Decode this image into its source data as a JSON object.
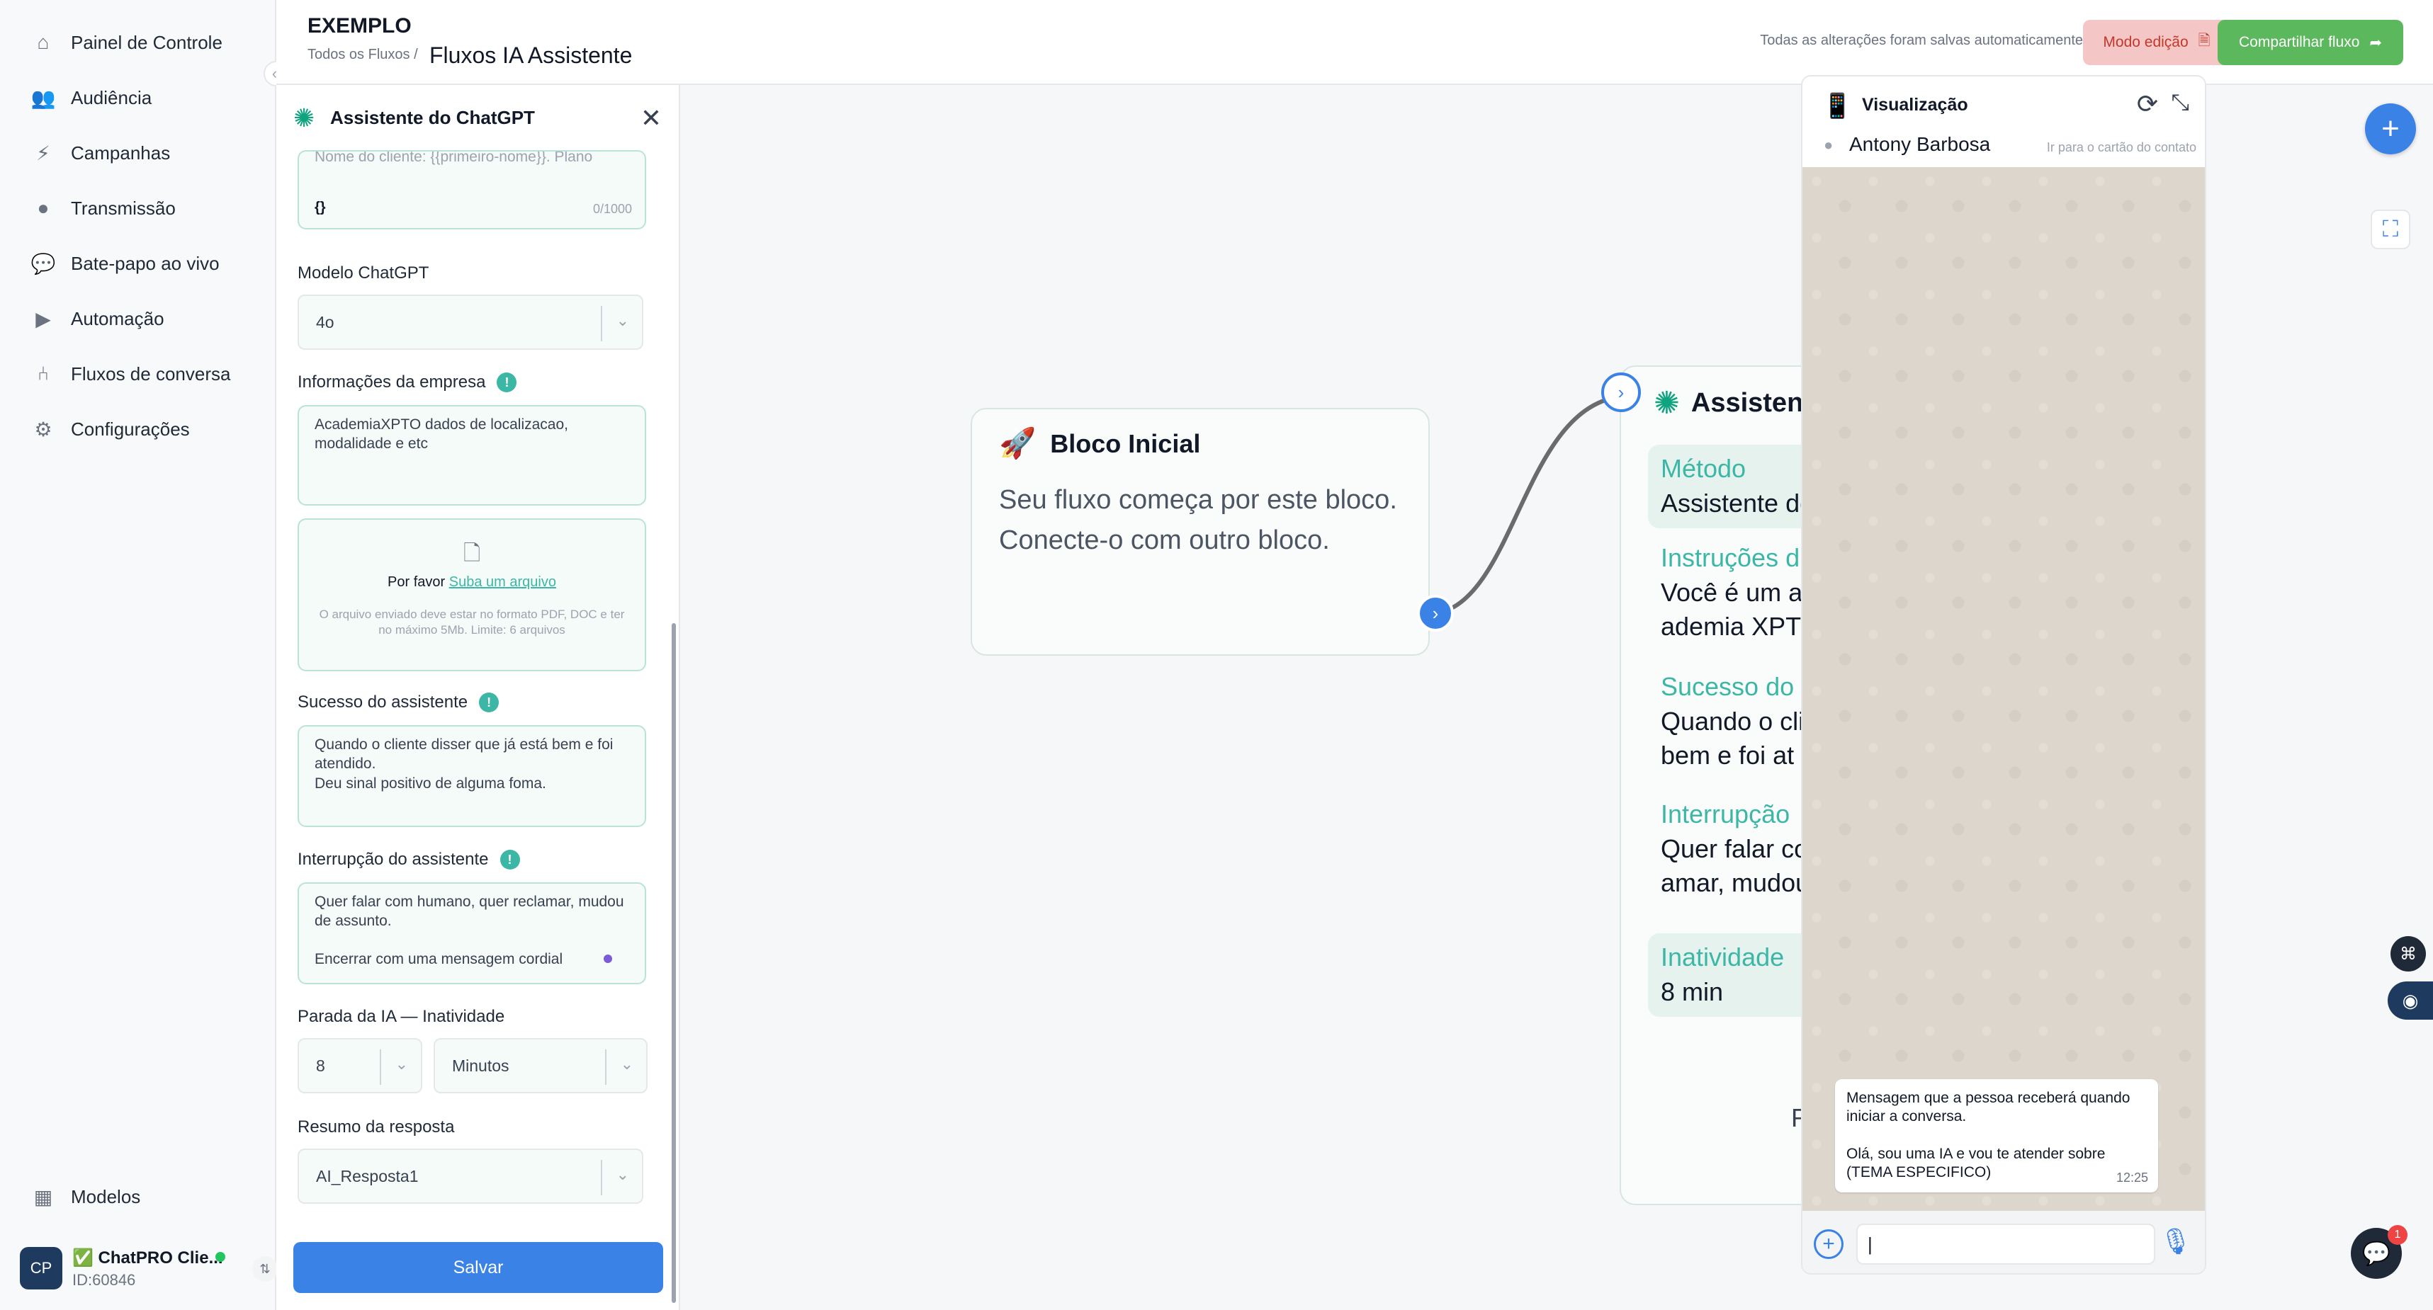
{
  "nav": {
    "items": [
      {
        "label": "Painel de Controle",
        "icon": "home-icon"
      },
      {
        "label": "Audiência",
        "icon": "users-icon"
      },
      {
        "label": "Campanhas",
        "icon": "lightning-icon"
      },
      {
        "label": "Transmissão",
        "icon": "broadcast-icon"
      },
      {
        "label": "Bate-papo ao vivo",
        "icon": "chat-bubble-icon"
      },
      {
        "label": "Automação",
        "icon": "play-icon"
      },
      {
        "label": "Fluxos de conversa",
        "icon": "flow-icon"
      },
      {
        "label": "Configurações",
        "icon": "gear-icon"
      }
    ],
    "bottom_item": {
      "label": "Modelos",
      "icon": "templates-icon"
    },
    "account": {
      "name": "✅ ChatPRO Clie...",
      "id": "ID:60846",
      "logo_text": "CP"
    }
  },
  "header": {
    "org": "EXEMPLO",
    "breadcrumb": "Todos os Fluxos /",
    "title": "Fluxos IA Assistente",
    "saved_status": "Todas as alterações foram salvas automaticamente",
    "edit_label": "Modo edição",
    "share_label": "Compartilhar fluxo"
  },
  "panel": {
    "title": "Assistente do ChatGPT",
    "prompt_partial": "Nome do cliente: {{primeiro-nome}}. Plano",
    "prompt_var": "{}",
    "prompt_count": "0/1000",
    "model_label": "Modelo ChatGPT",
    "model_value": "4o",
    "company_label": "Informações da empresa",
    "company_value": "AcademiaXPTO dados de localizacao, modalidade e etc",
    "upload_prefix": "Por favor",
    "upload_link": "Suba um arquivo",
    "upload_note": "O arquivo enviado deve estar no formato PDF, DOC e ter no máximo 5Mb. Limite: 6 arquivos",
    "success_label": "Sucesso do assistente",
    "success_value_1": "Quando o cliente disser que já está bem e foi atendido.",
    "success_value_2": "Deu sinal positivo de alguma foma.",
    "interrupt_label": "Interrupção do assistente",
    "interrupt_value_1": "Quer falar com humano, quer reclamar, mudou de assunto.",
    "interrupt_value_2": "Encerrar com uma mensagem cordial",
    "inactivity_label": "Parada da IA — Inatividade",
    "inactivity_value": "8",
    "inactivity_unit": "Minutos",
    "summary_label": "Resumo da resposta",
    "summary_value": "AI_Resposta1",
    "save_label": "Salvar",
    "info_glyph": "!"
  },
  "canvas": {
    "start_block": {
      "title": "Bloco Inicial",
      "body": "Seu fluxo começa por este bloco. Conecte-o com outro bloco."
    },
    "ai_block": {
      "title": "Assisten",
      "method_key": "Método",
      "method_val": "Assistente de",
      "instr_key": "Instruções d",
      "instr_val": "Você é um at ademia XPTO",
      "success_key": "Sucesso do",
      "success_val": "Quando o clie á bem e foi at",
      "interrupt_key": "Interrupção",
      "interrupt_val": "Quer falar co amar, mudou",
      "inactivity_key": "Inatividade",
      "inactivity_val": "8 min",
      "footer": "R"
    }
  },
  "preview": {
    "title": "Visualização",
    "contact": "Antony Barbosa",
    "goto_contact": "Ir para o cartão do contato",
    "bubble_line1": "Mensagem que a pessoa receberá quando iniciar a conversa.",
    "bubble_line2": "Olá, sou uma IA e vou te atender sobre (TEMA ESPECIFICO)",
    "bubble_time": "12:25",
    "input_value": "|"
  },
  "floating": {
    "notification_count": "1"
  }
}
